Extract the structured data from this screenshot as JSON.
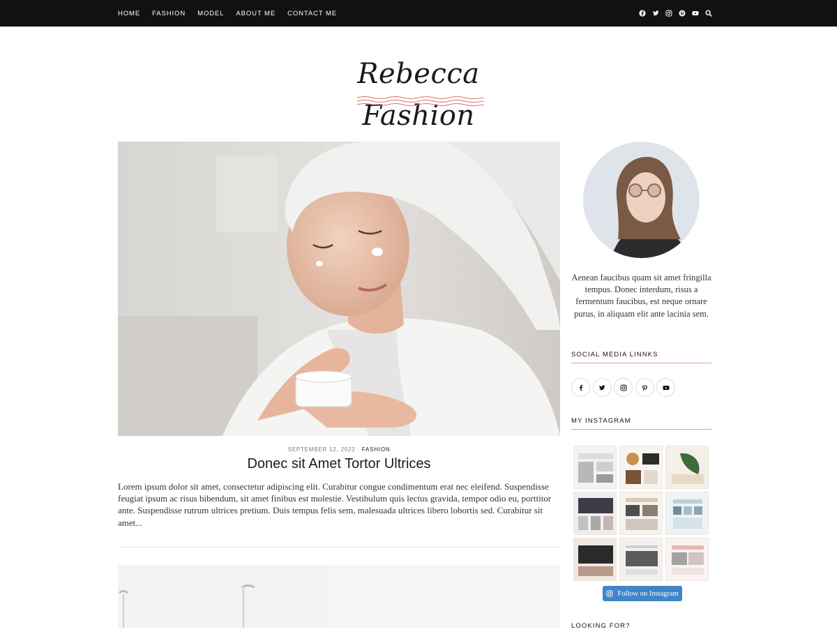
{
  "nav": {
    "items": [
      {
        "label": "HOME"
      },
      {
        "label": "FASHION"
      },
      {
        "label": "MODEL"
      },
      {
        "label": "ABOUT ME"
      },
      {
        "label": "CONTACT ME"
      }
    ],
    "icons": [
      "facebook-icon",
      "twitter-icon",
      "instagram-icon",
      "pinterest-icon",
      "youtube-icon",
      "search-icon"
    ]
  },
  "logo": {
    "text": "Rebecca Fashion",
    "underline_color": "#d9736b"
  },
  "post": {
    "date": "SEPTEMBER 12, 2022",
    "category": "FASHION",
    "title": "Donec sit Amet Tortor Ultrices",
    "excerpt": "Lorem ipsum dolor sit amet, consectetur adipiscing elit. Curabitur congue condimentum erat nec eleifend. Suspendisse feugiat ipsum ac risus bibendum, sit amet finibus est molestie. Vestibulum quis lectus gravida, tempor odio eu, porttitor ante. Suspendisse rutrum ultrices pretium. Duis tempus felis sem, malesuada ultrices libero lobortis sed. Curabitur sit amet..."
  },
  "sidebar": {
    "about": "Aenean faucibus quam sit amet fringilla tempus. Donec interdum, risus a fermentum faucibus, est neque ornare purus, in aliquam elit ante lacinia sem.",
    "social_title": "SOCIAL MEDIA LINNKS",
    "social_icons": [
      "facebook-icon",
      "twitter-icon",
      "instagram-icon",
      "pinterest-icon",
      "youtube-icon"
    ],
    "instagram_title": "MY INSTAGRAM",
    "instagram_tiles": 9,
    "follow_label": "Follow on Instagram",
    "next_widget_title": "LOOKING FOR?"
  },
  "colors": {
    "topbar": "#111111",
    "accent": "#e89a92",
    "follow_button": "#3f86c8"
  }
}
